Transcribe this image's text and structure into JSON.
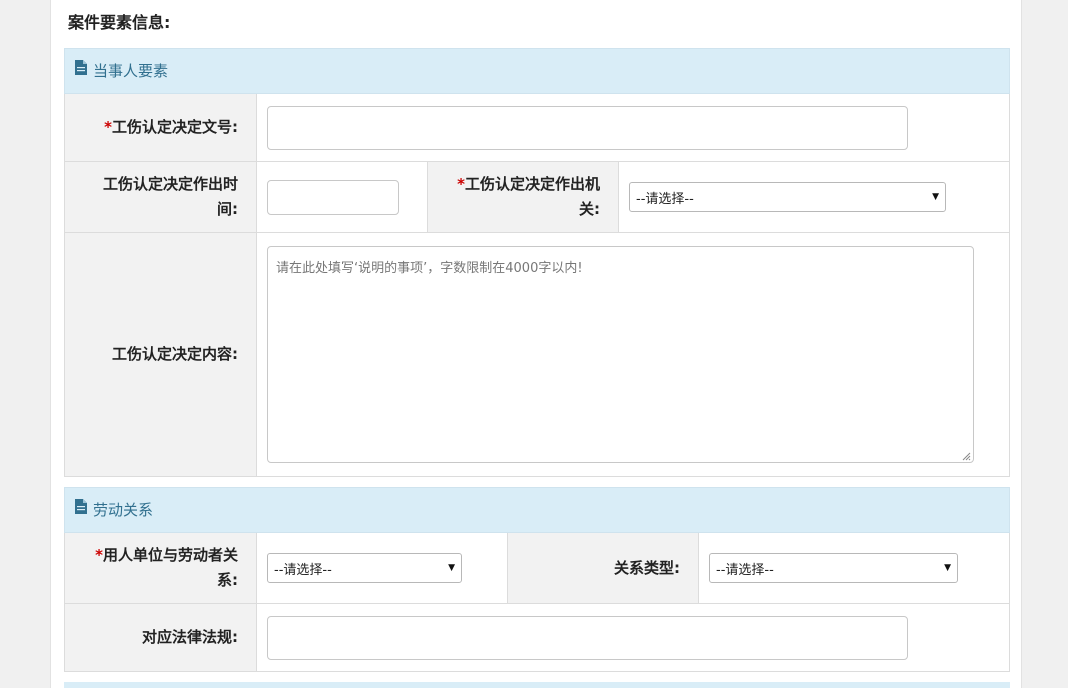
{
  "page_title": "案件要素信息:",
  "sections": {
    "party": {
      "title": "当事人要素",
      "decision_no_label": "工伤认定决定文号:",
      "decision_no_value": "",
      "decision_time_label": "工伤认定决定作出时间:",
      "decision_time_value": "",
      "decision_org_label": "工伤认定决定作出机关:",
      "decision_org_selected": "--请选择--",
      "content_label": "工伤认定决定内容:",
      "content_placeholder": "请在此处填写‘说明的事项’，字数限制在4000字以内!"
    },
    "labor": {
      "title": "劳动关系",
      "relation_label": "用人单位与劳动者关系:",
      "relation_selected": "--请选择--",
      "relation_type_label": "关系类型:",
      "relation_type_selected": "--请选择--",
      "law_label": "对应法律法规:",
      "law_value": ""
    }
  },
  "required_mark": "*",
  "colors": {
    "panel_bg": "#d9edf7",
    "panel_text": "#31708f",
    "label_bg": "#f2f2f2",
    "required": "#cc0000"
  },
  "icons": {
    "section_icon": "document-icon",
    "resize_icon": "resize-grip-icon"
  }
}
